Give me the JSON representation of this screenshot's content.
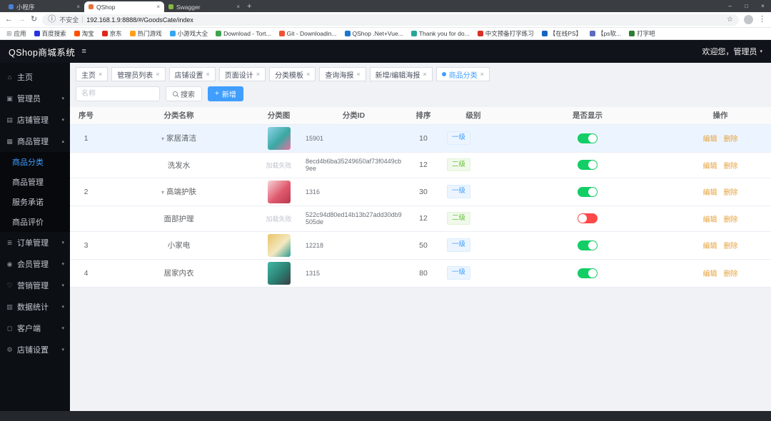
{
  "icons": {
    "close": "×",
    "plus": "+",
    "back": "←",
    "forward": "→",
    "reload": "↻",
    "info": "ⓘ",
    "star": "☆",
    "dots": "⋮",
    "minimize": "–",
    "maximize": "□",
    "window_close": "×",
    "chevron_down": "▾",
    "chevron_up": "▴",
    "caret_down": "▾",
    "expand": "▾",
    "new_tab": "+",
    "apps_grid": "⊞",
    "collapse": "≡"
  },
  "browser": {
    "tabs": [
      {
        "label": "小程序",
        "favicon_color": "#4a7fd4",
        "active": false
      },
      {
        "label": "QShop",
        "favicon_color": "#e8733a",
        "active": true
      },
      {
        "label": "Swagger",
        "favicon_color": "#85ba3f",
        "active": false
      }
    ],
    "security_label": "不安全",
    "url": "192.168.1.9:8888/#/GoodsCate/index",
    "bookmarks": [
      {
        "label": "应用",
        "color": "#9aa0a6",
        "grid": true
      },
      {
        "label": "百度搜索",
        "color": "#2932e1"
      },
      {
        "label": "淘宝",
        "color": "#ff5000"
      },
      {
        "label": "京东",
        "color": "#e1251b"
      },
      {
        "label": "热门游戏",
        "color": "#ff9f1c"
      },
      {
        "label": "小游戏大全",
        "color": "#35a6f0"
      },
      {
        "label": "Download - Tort...",
        "color": "#3fa34d"
      },
      {
        "label": "Git - Downloadin...",
        "color": "#f05133"
      },
      {
        "label": "QShop .Net+Vue...",
        "color": "#1976d2"
      },
      {
        "label": "Thank you for do...",
        "color": "#26a69a"
      },
      {
        "label": "中文预备打字练习",
        "color": "#d93025"
      },
      {
        "label": "【在线PS】",
        "color": "#1565c0"
      },
      {
        "label": "【ps软...",
        "color": "#5c6bc0"
      },
      {
        "label": "打字吧",
        "color": "#2e7d32"
      }
    ]
  },
  "app": {
    "title": "QShop商城系统",
    "welcome": "欢迎您，管理员"
  },
  "sidebar": {
    "items": [
      {
        "label": "主页",
        "icon": "⌂"
      },
      {
        "label": "管理员",
        "icon": "▣",
        "chevron": "▾"
      },
      {
        "label": "店铺管理",
        "icon": "▤",
        "chevron": "▾"
      },
      {
        "label": "商品管理",
        "icon": "▦",
        "chevron": "▴",
        "children": [
          {
            "label": "商品分类",
            "active": true
          },
          {
            "label": "商品管理"
          },
          {
            "label": "服务承诺"
          },
          {
            "label": "商品评价"
          }
        ]
      },
      {
        "label": "订单管理",
        "icon": "≣",
        "chevron": "▾"
      },
      {
        "label": "会员管理",
        "icon": "◉",
        "chevron": "▾"
      },
      {
        "label": "营销管理",
        "icon": "♡",
        "chevron": "▾"
      },
      {
        "label": "数据统计",
        "icon": "▥",
        "chevron": "▾"
      },
      {
        "label": "客户端",
        "icon": "◻",
        "chevron": "▾"
      },
      {
        "label": "店铺设置",
        "icon": "⚙",
        "chevron": "▾"
      }
    ]
  },
  "page_tabs": [
    {
      "label": "主页"
    },
    {
      "label": "管理员列表"
    },
    {
      "label": "店铺设置"
    },
    {
      "label": "页面设计"
    },
    {
      "label": "分类模板"
    },
    {
      "label": "查询海报"
    },
    {
      "label": "新增/编辑海报"
    },
    {
      "label": "商品分类",
      "active": true
    }
  ],
  "toolbar": {
    "search_placeholder": "名称",
    "search_label": "搜索",
    "add_label": "新增"
  },
  "table": {
    "headers": [
      "序号",
      "分类名称",
      "分类图",
      "分类ID",
      "排序",
      "级别",
      "是否显示",
      "操作"
    ],
    "actions": {
      "edit": "编辑",
      "delete": "删除"
    },
    "image_fail_text": "加载失败",
    "rows": [
      {
        "seq": "1",
        "name": "家居清洁",
        "has_children": true,
        "image": {
          "failed": false,
          "colors": [
            "#8fd3e8",
            "#3aa7a3",
            "#e6739f"
          ]
        },
        "cate_id": "15901",
        "sort": "10",
        "level": "一级",
        "level_type": "primary",
        "visible": true,
        "highlight": true
      },
      {
        "seq": "",
        "name": "洗发水",
        "is_child": true,
        "image": {
          "failed": true
        },
        "cate_id": "8ecd4b6ba35249650af73f0449cb9ee",
        "sort": "12",
        "level": "二级",
        "level_type": "success",
        "visible": true
      },
      {
        "seq": "2",
        "name": "高端护肤",
        "has_children": true,
        "image": {
          "failed": false,
          "colors": [
            "#f6d4d8",
            "#e05a6d",
            "#b8384e"
          ]
        },
        "cate_id": "1316",
        "sort": "30",
        "level": "一级",
        "level_type": "primary",
        "visible": true
      },
      {
        "seq": "",
        "name": "面部护理",
        "is_child": true,
        "image": {
          "failed": true
        },
        "cate_id": "522c94d80ed14b13b27add30db9505de",
        "sort": "12",
        "level": "二级",
        "level_type": "success",
        "visible": false
      },
      {
        "seq": "3",
        "name": "小家电",
        "image": {
          "failed": false,
          "colors": [
            "#e9c46a",
            "#f4e8c1",
            "#2a9d8f"
          ]
        },
        "cate_id": "12218",
        "sort": "50",
        "level": "一级",
        "level_type": "primary",
        "visible": true
      },
      {
        "seq": "4",
        "name": "居家内衣",
        "image": {
          "failed": false,
          "colors": [
            "#43b8a5",
            "#2a7f72",
            "#3a3f44"
          ]
        },
        "cate_id": "1315",
        "sort": "80",
        "level": "一级",
        "level_type": "primary",
        "visible": true
      }
    ]
  }
}
